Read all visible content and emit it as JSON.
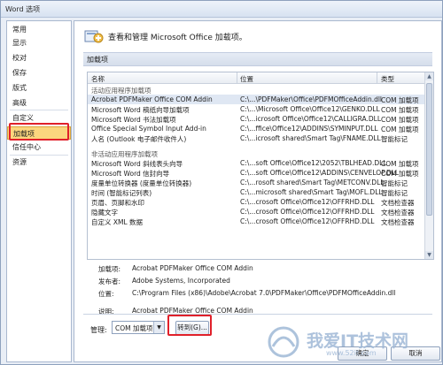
{
  "window": {
    "title": "Word 选项"
  },
  "sidebar": {
    "items": [
      {
        "label": "常用"
      },
      {
        "label": "显示"
      },
      {
        "label": "校对"
      },
      {
        "label": "保存"
      },
      {
        "label": "版式"
      },
      {
        "label": "高级"
      },
      {
        "label": "自定义"
      },
      {
        "label": "加载项"
      },
      {
        "label": "信任中心"
      },
      {
        "label": "资源"
      }
    ],
    "selected": "加载项"
  },
  "main": {
    "header_title": "查看和管理 Microsoft Office 加载项。",
    "section_title": "加载项",
    "columns": [
      "名称",
      "位置",
      "类型"
    ],
    "groups": [
      {
        "title": "活动应用程序加载项",
        "rows": [
          {
            "name": "Acrobat PDFMaker Office COM Addin",
            "location": "C:\\...\\PDFMaker\\Office\\PDFMOfficeAddin.dll",
            "type": "COM 加载项"
          },
          {
            "name": "Microsoft Word 稿纸向导加载项",
            "location": "C:\\...\\Microsoft Office\\Office12\\GENKO.DLL",
            "type": "COM 加载项"
          },
          {
            "name": "Microsoft Word 书法加载项",
            "location": "C:\\...icrosoft Office\\Office12\\CALLIGRA.DLL",
            "type": "COM 加载项"
          },
          {
            "name": "Office Special Symbol Input Add-in",
            "location": "C:\\...ffice\\Office12\\ADDINS\\SYMINPUT.DLL",
            "type": "COM 加载项"
          },
          {
            "name": "人名 (Outlook 电子邮件收件人)",
            "location": "C:\\...icrosoft shared\\Smart Tag\\FNAME.DLL",
            "type": "智能标记"
          }
        ]
      },
      {
        "title": "非活动应用程序加载项",
        "rows": [
          {
            "name": "Microsoft Word 斜线表头向导",
            "location": "C:\\...soft Office\\Office12\\2052\\TBLHEAD.DLL",
            "type": "COM 加载项"
          },
          {
            "name": "Microsoft Word 信封向导",
            "location": "C:\\...soft Office\\Office12\\ADDINS\\CENVELOP.DLL",
            "type": "COM 加载项"
          },
          {
            "name": "度量单位转换器 (度量单位转换器)",
            "location": "C:\\...rosoft shared\\Smart Tag\\METCONV.DLL",
            "type": "智能标记"
          },
          {
            "name": "时间 (智能标记列表)",
            "location": "C:\\...microsoft shared\\Smart Tag\\MOFL.DLL",
            "type": "智能标记"
          },
          {
            "name": "页眉、页脚和水印",
            "location": "C:\\...crosoft Office\\Office12\\OFFRHD.DLL",
            "type": "文档检查器"
          },
          {
            "name": "隐藏文字",
            "location": "C:\\...crosoft Office\\Office12\\OFFRHD.DLL",
            "type": "文档检查器"
          },
          {
            "name": "自定义 XML 数据",
            "location": "C:\\...crosoft Office\\Office12\\OFFRHD.DLL",
            "type": "文档检查器"
          }
        ]
      }
    ],
    "details": {
      "addin_label": "加载项:",
      "addin_value": "Acrobat PDFMaker Office COM Addin",
      "publisher_label": "发布者:",
      "publisher_value": "Adobe Systems, Incorporated",
      "location_label": "位置:",
      "location_value": "C:\\Program Files (x86)\\Adobe\\Acrobat 7.0\\PDFMaker\\Office\\PDFMOfficeAddin.dll",
      "description_label": "说明:",
      "description_value": "Acrobat PDFMaker Office COM Addin"
    },
    "manage": {
      "label": "管理:",
      "selected": "COM 加载项",
      "go_label": "转到(G)..."
    }
  },
  "footer": {
    "ok_label": "确定",
    "cancel_label": "取消"
  },
  "watermark": {
    "text": "我爱IT技术网",
    "sub": "www.52it.com"
  },
  "colors": {
    "highlight": "#e0202a",
    "selection": "#fbd67e"
  }
}
